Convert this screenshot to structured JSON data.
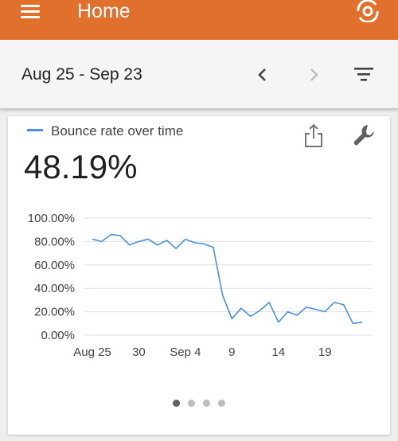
{
  "app_bar": {
    "title": "Home",
    "menu_icon": "hamburger-menu-icon",
    "logo_icon": "analytics-logo-icon",
    "color": "#e0702b"
  },
  "date_bar": {
    "range": "Aug 25 - Sep 23",
    "prev_icon": "chevron-left-icon",
    "next_icon": "chevron-right-icon",
    "filter_icon": "filter-icon"
  },
  "card": {
    "legend_label": "Bounce rate over time",
    "value": "48.19%",
    "share_icon": "share-icon",
    "settings_icon": "wrench-icon",
    "series_color": "#4a90e2",
    "page_indicator": {
      "count": 4,
      "active": 0
    }
  },
  "chart_data": {
    "type": "line",
    "ylim": [
      0,
      100
    ],
    "y_ticks": [
      "0.00%",
      "20.00%",
      "40.00%",
      "60.00%",
      "80.00%",
      "100.00%"
    ],
    "x_tick_labels": [
      "Aug 25",
      "30",
      "Sep 4",
      "9",
      "14",
      "19"
    ],
    "x": [
      "Aug 25",
      "Aug 26",
      "Aug 27",
      "Aug 28",
      "Aug 29",
      "Aug 30",
      "Aug 31",
      "Sep 1",
      "Sep 2",
      "Sep 3",
      "Sep 4",
      "Sep 5",
      "Sep 6",
      "Sep 7",
      "Sep 8",
      "Sep 9",
      "Sep 10",
      "Sep 11",
      "Sep 12",
      "Sep 13",
      "Sep 14",
      "Sep 15",
      "Sep 16",
      "Sep 17",
      "Sep 18",
      "Sep 19",
      "Sep 20",
      "Sep 21",
      "Sep 22",
      "Sep 23"
    ],
    "series": [
      {
        "name": "Bounce rate over time",
        "values": [
          82,
          80,
          86,
          85,
          77,
          80,
          82,
          77,
          81,
          74,
          82,
          79,
          78,
          75,
          34,
          14,
          23,
          16,
          21,
          28,
          11,
          20,
          17,
          24,
          22,
          20,
          28,
          26,
          10,
          11
        ]
      }
    ]
  }
}
